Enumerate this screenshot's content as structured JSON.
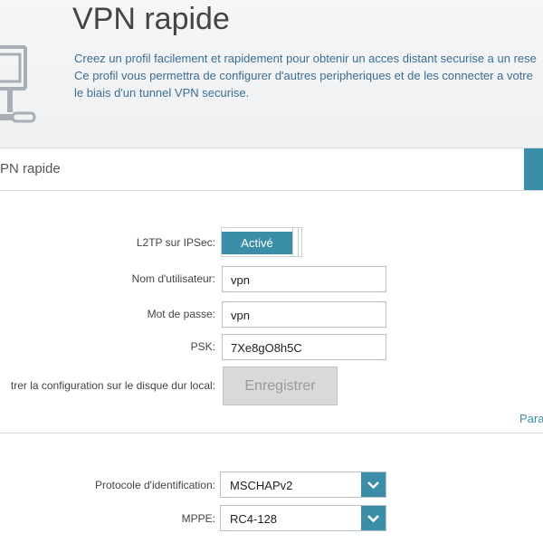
{
  "header": {
    "title": "VPN rapide",
    "description_lines": [
      "Creez un profil facilement et rapidement pour obtenir un acces distant securise a un rese",
      "Ce profil vous permettra de configurer d'autres peripheriques et de les connecter a votre",
      "le biais d'un tunnel VPN securise."
    ]
  },
  "section": {
    "title": "PN rapide"
  },
  "form": {
    "l2tp": {
      "label": "L2TP sur IPSec:",
      "state": "Activé"
    },
    "username": {
      "label": "Nom d'utilisateur:",
      "value": "vpn"
    },
    "password": {
      "label": "Mot de passe:",
      "value": "vpn"
    },
    "psk": {
      "label": "PSK:",
      "value": "7Xe8gO8h5C"
    },
    "save": {
      "label": "trer la configuration sur le disque dur local:",
      "button": "Enregistrer"
    },
    "advanced_link": "Para"
  },
  "advanced": {
    "auth_protocol": {
      "label": "Protocole d'identification:",
      "value": "MSCHAPv2"
    },
    "mppe": {
      "label": "MPPE:",
      "value": "RC4-128"
    }
  },
  "colors": {
    "accent": "#3a8ea8",
    "description_text": "#3b6e96",
    "disabled_button": "#d9d9d9"
  },
  "icons": [
    "device-icon",
    "chevron-down-icon"
  ]
}
